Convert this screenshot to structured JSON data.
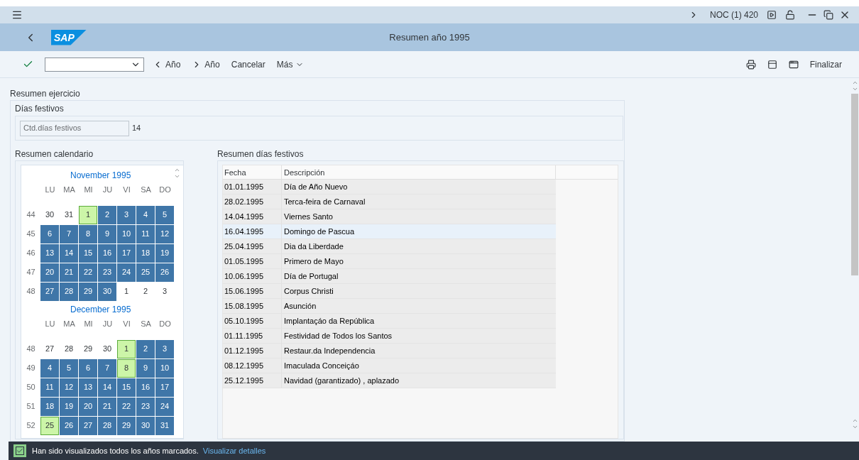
{
  "system_bar": {
    "system": "NOC (1) 420"
  },
  "header": {
    "logo": "SAP",
    "title": "Resumen año 1995"
  },
  "toolbar": {
    "buttons": [
      {
        "kind": "prev",
        "label": "Año"
      },
      {
        "kind": "next",
        "label": "Año"
      },
      {
        "kind": "plain",
        "label": "Cancelar"
      },
      {
        "kind": "menu",
        "label": "Más"
      }
    ],
    "finish": "Finalizar"
  },
  "section_title": "Resumen ejercicio",
  "holidays_group": {
    "title": "Días festivos",
    "field_label": "Ctd.días festivos",
    "field_value": "14"
  },
  "calendar": {
    "title": "Resumen calendario",
    "months": [
      {
        "name": "November 1995",
        "weekdays": [
          "LU",
          "MA",
          "MI",
          "JU",
          "VI",
          "SA",
          "DO"
        ],
        "weeks": [
          {
            "week": "44",
            "days": [
              {
                "day": "30",
                "kind": "other"
              },
              {
                "day": "31",
                "kind": "other"
              },
              {
                "day": "1",
                "kind": "holiday"
              },
              {
                "day": "2",
                "kind": "workday"
              },
              {
                "day": "3",
                "kind": "workday"
              },
              {
                "day": "4",
                "kind": "workday"
              },
              {
                "day": "5",
                "kind": "workday"
              }
            ]
          },
          {
            "week": "45",
            "days": [
              {
                "day": "6",
                "kind": "workday"
              },
              {
                "day": "7",
                "kind": "workday"
              },
              {
                "day": "8",
                "kind": "workday"
              },
              {
                "day": "9",
                "kind": "workday"
              },
              {
                "day": "10",
                "kind": "workday"
              },
              {
                "day": "11",
                "kind": "workday"
              },
              {
                "day": "12",
                "kind": "workday"
              }
            ]
          },
          {
            "week": "46",
            "days": [
              {
                "day": "13",
                "kind": "workday"
              },
              {
                "day": "14",
                "kind": "workday"
              },
              {
                "day": "15",
                "kind": "workday"
              },
              {
                "day": "16",
                "kind": "workday"
              },
              {
                "day": "17",
                "kind": "workday"
              },
              {
                "day": "18",
                "kind": "workday"
              },
              {
                "day": "19",
                "kind": "workday"
              }
            ]
          },
          {
            "week": "47",
            "days": [
              {
                "day": "20",
                "kind": "workday"
              },
              {
                "day": "21",
                "kind": "workday"
              },
              {
                "day": "22",
                "kind": "workday"
              },
              {
                "day": "23",
                "kind": "workday"
              },
              {
                "day": "24",
                "kind": "workday"
              },
              {
                "day": "25",
                "kind": "workday"
              },
              {
                "day": "26",
                "kind": "workday"
              }
            ]
          },
          {
            "week": "48",
            "days": [
              {
                "day": "27",
                "kind": "workday"
              },
              {
                "day": "28",
                "kind": "workday"
              },
              {
                "day": "29",
                "kind": "workday"
              },
              {
                "day": "30",
                "kind": "workday"
              },
              {
                "day": "1",
                "kind": "other"
              },
              {
                "day": "2",
                "kind": "other"
              },
              {
                "day": "3",
                "kind": "other"
              }
            ]
          }
        ]
      },
      {
        "name": "December 1995",
        "weekdays": [
          "LU",
          "MA",
          "MI",
          "JU",
          "VI",
          "SA",
          "DO"
        ],
        "weeks": [
          {
            "week": "48",
            "days": [
              {
                "day": "27",
                "kind": "other"
              },
              {
                "day": "28",
                "kind": "other"
              },
              {
                "day": "29",
                "kind": "other"
              },
              {
                "day": "30",
                "kind": "other"
              },
              {
                "day": "1",
                "kind": "holiday"
              },
              {
                "day": "2",
                "kind": "workday"
              },
              {
                "day": "3",
                "kind": "workday"
              }
            ]
          },
          {
            "week": "49",
            "days": [
              {
                "day": "4",
                "kind": "workday"
              },
              {
                "day": "5",
                "kind": "workday"
              },
              {
                "day": "6",
                "kind": "workday"
              },
              {
                "day": "7",
                "kind": "workday"
              },
              {
                "day": "8",
                "kind": "holiday"
              },
              {
                "day": "9",
                "kind": "workday"
              },
              {
                "day": "10",
                "kind": "workday"
              }
            ]
          },
          {
            "week": "50",
            "days": [
              {
                "day": "11",
                "kind": "workday"
              },
              {
                "day": "12",
                "kind": "workday"
              },
              {
                "day": "13",
                "kind": "workday"
              },
              {
                "day": "14",
                "kind": "workday"
              },
              {
                "day": "15",
                "kind": "workday"
              },
              {
                "day": "16",
                "kind": "workday"
              },
              {
                "day": "17",
                "kind": "workday"
              }
            ]
          },
          {
            "week": "51",
            "days": [
              {
                "day": "18",
                "kind": "workday"
              },
              {
                "day": "19",
                "kind": "workday"
              },
              {
                "day": "20",
                "kind": "workday"
              },
              {
                "day": "21",
                "kind": "workday"
              },
              {
                "day": "22",
                "kind": "workday"
              },
              {
                "day": "23",
                "kind": "workday"
              },
              {
                "day": "24",
                "kind": "workday"
              }
            ]
          },
          {
            "week": "52",
            "days": [
              {
                "day": "25",
                "kind": "holiday"
              },
              {
                "day": "26",
                "kind": "workday"
              },
              {
                "day": "27",
                "kind": "workday"
              },
              {
                "day": "28",
                "kind": "workday"
              },
              {
                "day": "29",
                "kind": "workday"
              },
              {
                "day": "30",
                "kind": "workday"
              },
              {
                "day": "31",
                "kind": "workday"
              }
            ]
          }
        ]
      }
    ]
  },
  "holiday_table": {
    "title": "Resumen días festivos",
    "columns": [
      "Fecha",
      "Descripción"
    ],
    "rows": [
      {
        "date": "01.01.1995",
        "description": "Día de Año Nuevo",
        "selected": false
      },
      {
        "date": "28.02.1995",
        "description": "Terca-feira de Carnaval",
        "selected": false
      },
      {
        "date": "14.04.1995",
        "description": "Viernes Santo",
        "selected": false
      },
      {
        "date": "16.04.1995",
        "description": "Domingo de Pascua",
        "selected": true
      },
      {
        "date": "25.04.1995",
        "description": "Dia da Liberdade",
        "selected": false
      },
      {
        "date": "01.05.1995",
        "description": "Primero de Mayo",
        "selected": false
      },
      {
        "date": "10.06.1995",
        "description": "Día de Portugal",
        "selected": false
      },
      {
        "date": "15.06.1995",
        "description": "Corpus Christi",
        "selected": false
      },
      {
        "date": "15.08.1995",
        "description": "Asunción",
        "selected": false
      },
      {
        "date": "05.10.1995",
        "description": "Implantaçáo da República",
        "selected": false
      },
      {
        "date": "01.11.1995",
        "description": "Festividad de Todos los Santos",
        "selected": false
      },
      {
        "date": "01.12.1995",
        "description": "Restaur.da Independencia",
        "selected": false
      },
      {
        "date": "08.12.1995",
        "description": "Imaculada Conceiçáo",
        "selected": false
      },
      {
        "date": "25.12.1995",
        "description": "Navidad (garantizado) , aplazado",
        "selected": false
      }
    ]
  },
  "status_bar": {
    "message": "Han sido visualizados todos los años marcados.",
    "link": "Visualizar detalles"
  }
}
